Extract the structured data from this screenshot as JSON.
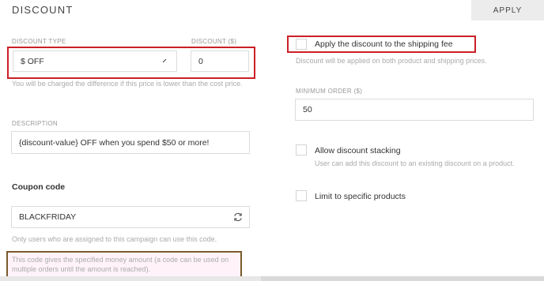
{
  "header": {
    "title": "DISCOUNT",
    "apply_label": "APPLY"
  },
  "discount_type": {
    "label": "DISCOUNT TYPE",
    "value": "$ OFF"
  },
  "discount_amount": {
    "label": "DISCOUNT ($)",
    "value": "0"
  },
  "price_helper": "You will be charged the difference if this price is lower than the cost price.",
  "description": {
    "label": "DESCRIPTION",
    "value": "{discount-value} OFF when you spend $50 or more!"
  },
  "coupon": {
    "title": "Coupon code",
    "value": "BLACKFRIDAY",
    "helper": "Only users who are assigned to this campaign can use this code.",
    "info": "This code gives the specified money amount (a code can be used on multiple orders until the amount is reached)."
  },
  "shipping": {
    "label": "Apply the discount to the shipping fee",
    "helper": "Discount will be applied on both product and shipping prices.",
    "checked": false
  },
  "minimum_order": {
    "label": "MINIMUM ORDER ($)",
    "value": "50"
  },
  "stacking": {
    "label": "Allow discount stacking",
    "helper": "User can add this discount to an existing discount on a product.",
    "checked": false
  },
  "specific_products": {
    "label": "Limit to specific products",
    "checked": false
  },
  "icons": {
    "select": "chevron-down-icon",
    "refresh": "refresh-icon"
  },
  "colors": {
    "highlight_red": "#cc1f26",
    "highlight_brown": "#7a5a2b",
    "apply_bg": "#ececec"
  }
}
